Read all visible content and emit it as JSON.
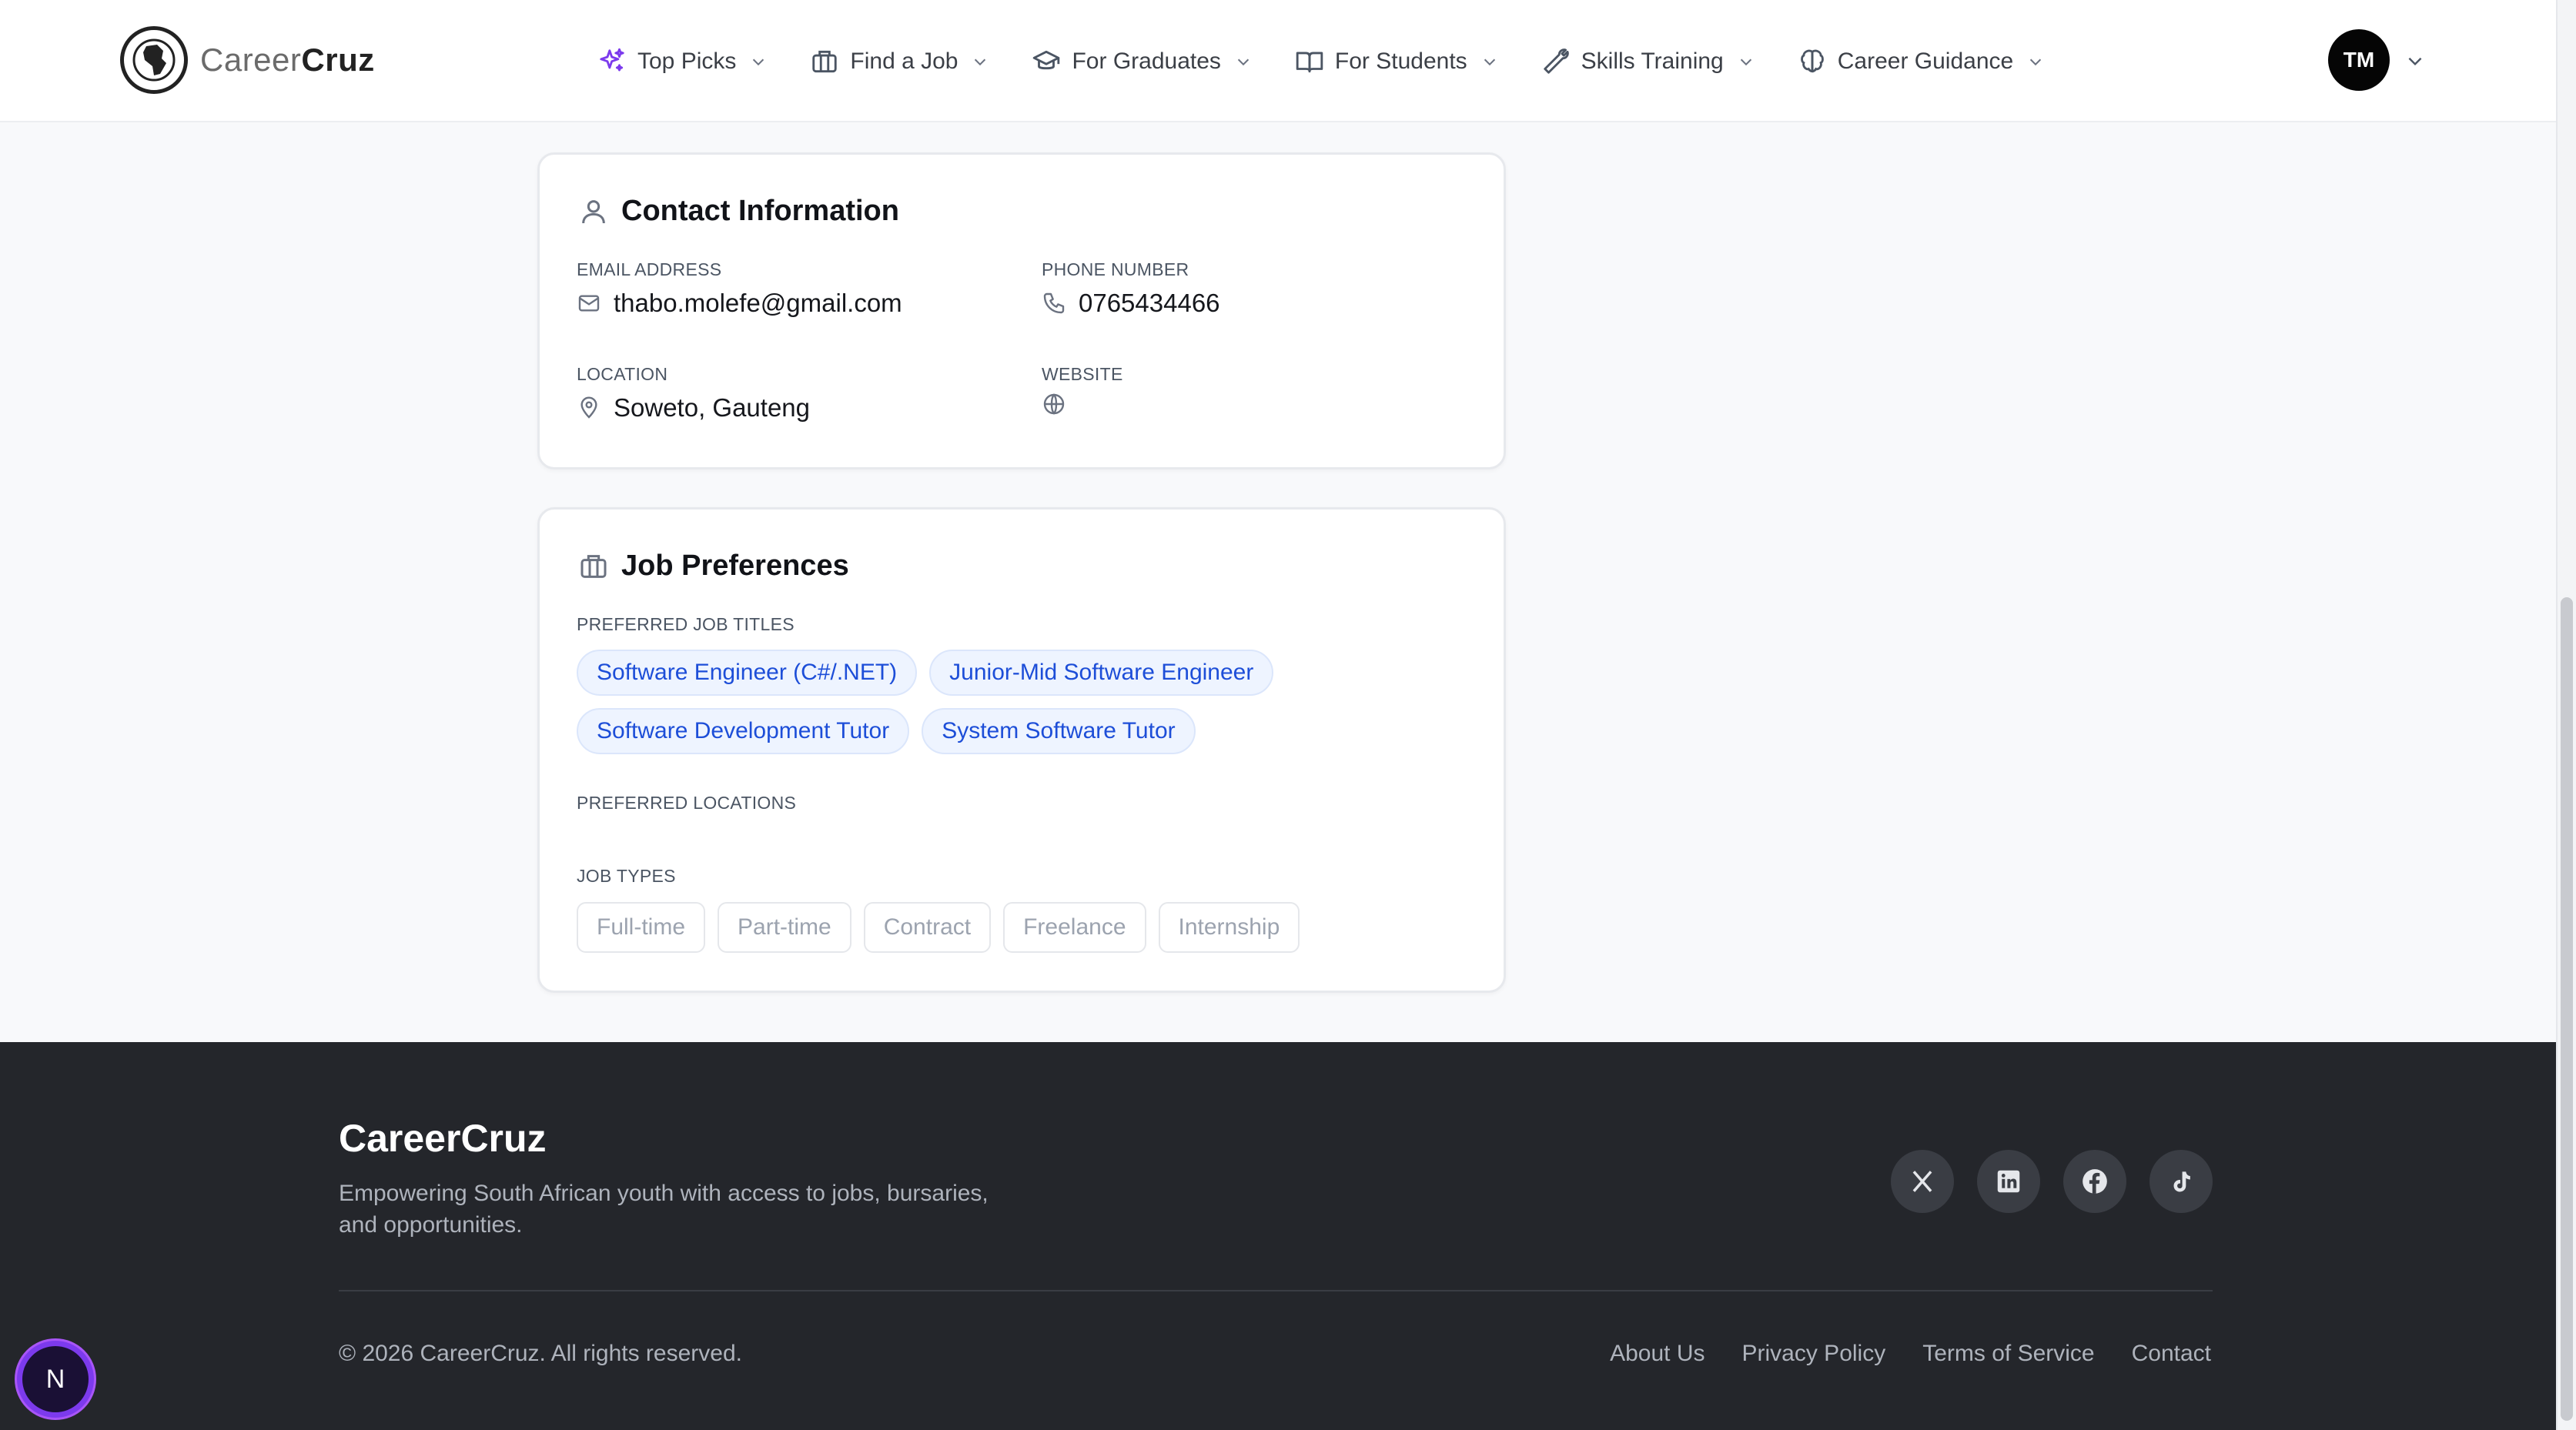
{
  "app": {
    "brand_prefix": "Career",
    "brand_suffix": "Cruz"
  },
  "nav": {
    "items": [
      {
        "label": "Top Picks",
        "icon": "sparkles-icon",
        "icon_color": "#7c3aed"
      },
      {
        "label": "Find a Job",
        "icon": "briefcase-icon"
      },
      {
        "label": "For Graduates",
        "icon": "graduation-cap-icon"
      },
      {
        "label": "For Students",
        "icon": "book-open-icon"
      },
      {
        "label": "Skills Training",
        "icon": "wrench-icon"
      },
      {
        "label": "Career Guidance",
        "icon": "brain-icon"
      }
    ],
    "avatar_initials": "TM"
  },
  "contact": {
    "title": "Contact Information",
    "email_label": "EMAIL ADDRESS",
    "email": "thabo.molefe@gmail.com",
    "phone_label": "PHONE NUMBER",
    "phone": "0765434466",
    "location_label": "LOCATION",
    "location": "Soweto, Gauteng",
    "website_label": "WEBSITE",
    "website": ""
  },
  "preferences": {
    "title": "Job Preferences",
    "titles_label": "PREFERRED JOB TITLES",
    "job_titles": [
      "Software Engineer (C#/.NET)",
      "Junior-Mid Software Engineer",
      "Software Development Tutor",
      "System Software Tutor"
    ],
    "locations_label": "PREFERRED LOCATIONS",
    "types_label": "JOB TYPES",
    "job_types": [
      "Full-time",
      "Part-time",
      "Contract",
      "Freelance",
      "Internship"
    ]
  },
  "footer": {
    "brand": "CareerCruz",
    "tagline": "Empowering South African youth with access to jobs, bursaries, and opportunities.",
    "socials": [
      "x-icon",
      "linkedin-icon",
      "facebook-icon",
      "tiktok-icon"
    ],
    "copyright": "© 2026 CareerCruz. All rights reserved.",
    "links": [
      "About Us",
      "Privacy Policy",
      "Terms of Service",
      "Contact"
    ]
  },
  "dev_badge": {
    "letter": "N"
  },
  "colors": {
    "accent": "#1d4ed8",
    "tag_bg": "#eef4ff",
    "footer_bg": "#24262b",
    "badge_ring": "#7c3aed"
  }
}
